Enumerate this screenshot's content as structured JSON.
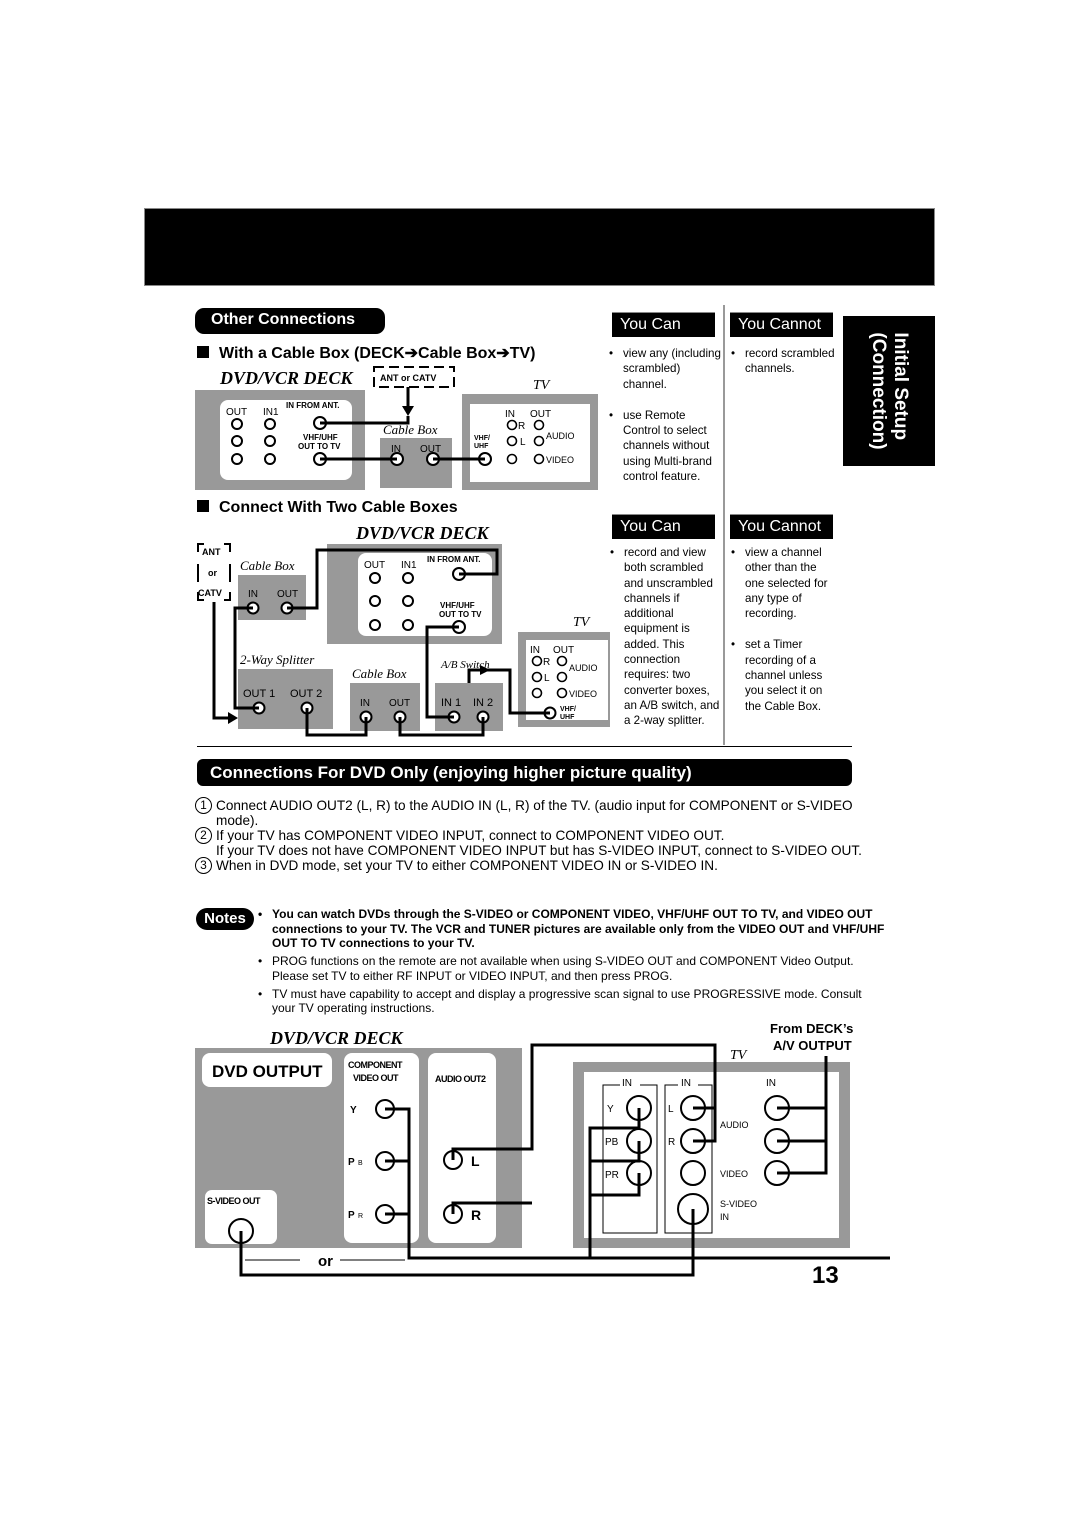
{
  "page": {
    "number": "13"
  },
  "side_tab": {
    "line1": "Initial Setup",
    "line2": "(Connection)"
  },
  "other_connections": {
    "title": "Other Connections",
    "section1": {
      "heading": "With a Cable Box (DECK➔Cable Box➔TV)",
      "labels": {
        "deck": "DVD/VCR DECK",
        "tv": "TV",
        "ant": "ANT or CATV",
        "cable_box": "Cable  Box",
        "out": "OUT",
        "in1": "IN1",
        "in_from_ant": "IN FROM ANT.",
        "vhf_uhf_out": "VHF/UHF",
        "out_to_tv": "OUT TO TV",
        "in": "IN",
        "vhf": "VHF/",
        "uhf": "UHF",
        "r": "R",
        "l": "L",
        "audio": "AUDIO",
        "video": "VIDEO"
      },
      "you_can": {
        "label": "You Can",
        "items": [
          "view any (including scrambled) channel.",
          "use Remote Control to select channels without using Multi-brand control feature."
        ]
      },
      "you_cannot": {
        "label": "You Cannot",
        "items": [
          "record scrambled channels."
        ]
      }
    },
    "section2": {
      "heading": "Connect With Two Cable Boxes",
      "labels": {
        "deck": "DVD/VCR DECK",
        "tv": "TV",
        "ant": "ANT",
        "or": "or",
        "catv": "CATV",
        "cable_box": "Cable  Box",
        "splitter": "2-Way  Splitter",
        "ab_switch": "A/B  Switch",
        "out1": "OUT 1",
        "out2": "OUT 2",
        "in1_sw": "IN 1",
        "in2_sw": "IN 2"
      },
      "you_can": {
        "label": "You Can",
        "items": [
          "record and view both scrambled and unscrambled channels if additional equipment is added. This connection requires: two converter boxes, an A/B switch, and a 2-way splitter."
        ]
      },
      "you_cannot": {
        "label": "You Cannot",
        "items": [
          "view a channel other than the one selected for any type of recording.",
          "set a Timer recording of a channel unless you select it on the Cable Box."
        ]
      }
    }
  },
  "dvd_only": {
    "title": "Connections For DVD Only (enjoying higher picture quality)",
    "steps": [
      {
        "num": "1",
        "text": "Connect AUDIO OUT2 (L, R) to the AUDIO IN (L, R) of the TV. (audio input for COMPONENT or S-VIDEO mode)."
      },
      {
        "num": "2",
        "text": "If your TV has COMPONENT VIDEO INPUT, connect to COMPONENT VIDEO OUT.",
        "extra": "If your TV does not have COMPONENT VIDEO INPUT but has S-VIDEO INPUT, connect to S-VIDEO OUT."
      },
      {
        "num": "3",
        "text": "When in DVD mode, set your TV to either COMPONENT VIDEO IN or S-VIDEO IN."
      }
    ],
    "notes_label": "Notes",
    "notes": [
      "You can watch DVDs through the S-VIDEO or COMPONENT VIDEO, VHF/UHF OUT TO TV, and VIDEO OUT connections to your TV. The VCR and TUNER pictures are available only from the VIDEO OUT and VHF/UHF OUT TO TV connections to your TV.",
      "PROG functions on the remote are not available when using S-VIDEO OUT and COMPONENT Video Output. Please set TV to either RF INPUT or VIDEO INPUT, and then press PROG.",
      "TV must have capability to accept and display a progressive scan signal to use PROGRESSIVE mode. Consult your TV operating instructions."
    ],
    "diagram": {
      "deck": "DVD/VCR DECK",
      "dvd_output": "DVD OUTPUT",
      "component1": "COMPONENT",
      "component2": "VIDEO OUT",
      "audio_out2": "AUDIO OUT2",
      "s_video_out": "S-VIDEO OUT",
      "y": "Y",
      "pb": "P",
      "pb_sub": "B",
      "pr": "P",
      "pr_sub": "R",
      "l": "L",
      "r": "R",
      "or": "or",
      "tv": "TV",
      "from1": "From DECK’s",
      "from2": "A/V OUTPUT",
      "in": "IN",
      "tv_y": "Y",
      "tv_pb": "PB",
      "tv_pr": "PR",
      "tv_l": "L",
      "tv_r": "R",
      "audio": "AUDIO",
      "video": "VIDEO",
      "svideo1": "S-VIDEO",
      "svideo2": "IN"
    }
  }
}
